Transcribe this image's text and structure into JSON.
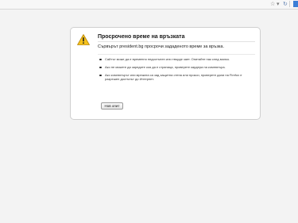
{
  "toolbar": {
    "icons": [
      "star-icon",
      "history-icon",
      "reload-icon",
      "search-icon"
    ]
  },
  "error": {
    "icon": "warning-icon",
    "title": "Просрочено време на връзката",
    "short_desc": "Сървърът president.bg просрочи зададеното време за връзка.",
    "bullets": [
      "Сайтът може да е временно недостъпен или твърде зает. Опитайте пак след малко.",
      "Ако не можете да заредите коя да е страница, проверете кардера на компютъра.",
      "Ако компютърът или мрежата са зад защитна стена или прокси, проверете дали на Firefox е разрешен достъпът до Интернет."
    ],
    "retry_label": "Нов опит"
  },
  "colors": {
    "page_bg": "#f3f3f3",
    "card_bg": "#ffffff",
    "warning_yellow": "#f5c21b",
    "accent_blue": "#3c7fd6"
  }
}
